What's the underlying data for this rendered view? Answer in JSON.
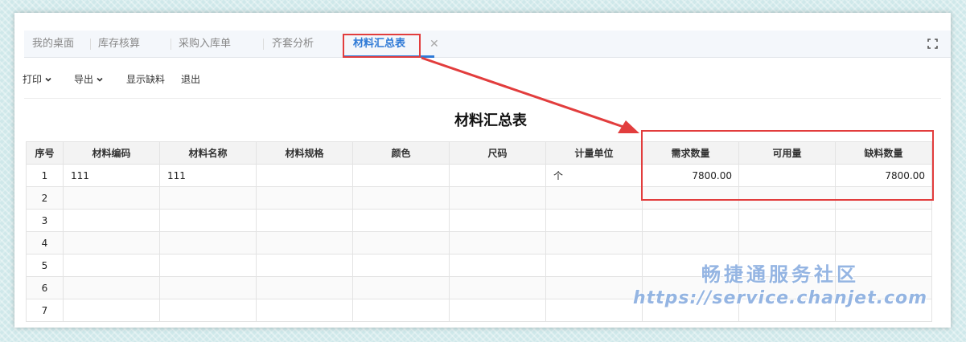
{
  "tabs": [
    {
      "label": "我的桌面",
      "active": false
    },
    {
      "label": "库存核算",
      "active": false
    },
    {
      "label": "采购入库单",
      "active": false
    },
    {
      "label": "齐套分析",
      "active": false
    },
    {
      "label": "材料汇总表",
      "active": true
    }
  ],
  "tab_close_glyph": "✕",
  "toolbar": {
    "print_label": "打印",
    "export_label": "导出",
    "show_shortage_label": "显示缺料",
    "exit_label": "退出"
  },
  "report_title": "材料汇总表",
  "table": {
    "columns": [
      "序号",
      "材料编码",
      "材料名称",
      "材料规格",
      "颜色",
      "尺码",
      "计量单位",
      "需求数量",
      "可用量",
      "缺料数量"
    ],
    "rows": [
      [
        "1",
        "111",
        "111",
        "",
        "",
        "",
        "个",
        "7800.00",
        "",
        "7800.00"
      ],
      [
        "2",
        "",
        "",
        "",
        "",
        "",
        "",
        "",
        "",
        ""
      ],
      [
        "3",
        "",
        "",
        "",
        "",
        "",
        "",
        "",
        "",
        ""
      ],
      [
        "4",
        "",
        "",
        "",
        "",
        "",
        "",
        "",
        "",
        ""
      ],
      [
        "5",
        "",
        "",
        "",
        "",
        "",
        "",
        "",
        "",
        ""
      ],
      [
        "6",
        "",
        "",
        "",
        "",
        "",
        "",
        "",
        "",
        ""
      ],
      [
        "7",
        "",
        "",
        "",
        "",
        "",
        "",
        "",
        "",
        ""
      ]
    ]
  },
  "watermark": {
    "line1": "畅捷通服务社区",
    "line2": "https://service.chanjet.com"
  },
  "colors": {
    "accent": "#2f7ad6",
    "highlight_red": "#e23d3d"
  }
}
